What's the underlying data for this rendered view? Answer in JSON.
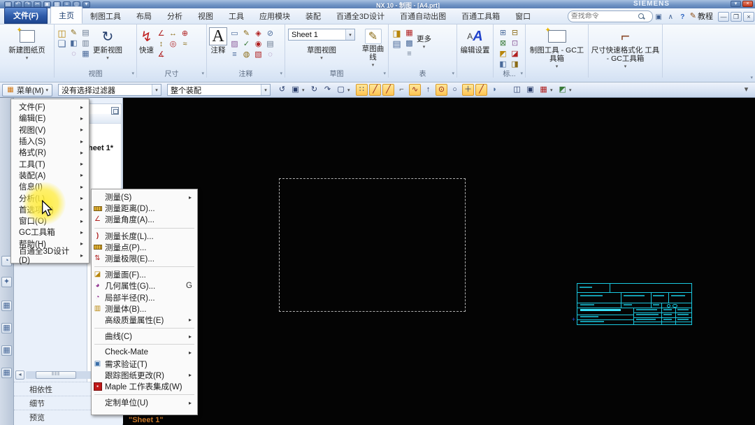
{
  "titlebar": {
    "title": "NX 10 - 制图 - [A4.prt]",
    "brand": "SIEMENS"
  },
  "tabrow": {
    "file_tab": "文件(F)",
    "tabs": [
      "主页",
      "制图工具",
      "布局",
      "分析",
      "视图",
      "工具",
      "应用模块",
      "装配",
      "百通全3D设计",
      "百通自动出图",
      "百通工具箱",
      "窗口"
    ],
    "active_tab": "主页",
    "search_placeholder": "查找命令",
    "tutorial_label": "教程"
  },
  "ribbon": {
    "new_sheet_label": "新建图纸页",
    "view_group": {
      "update_view_label": "更新视图",
      "group_label": "视图"
    },
    "dimension_group": {
      "rapid_label": "快速",
      "group_label": "尺寸"
    },
    "annotation_group": {
      "note_label": "注释",
      "group_label": "注释"
    },
    "sketch_group": {
      "sheet_combo_value": "Sheet 1",
      "sketch_view_label": "草图视图",
      "sketch_curve_label": "草图曲线",
      "group_label": "草图"
    },
    "table_group": {
      "more_label": "更多",
      "group_label": "表"
    },
    "edit_settings_label": "编辑设置",
    "standard_group_label": "标...",
    "gc_drafting_label": "制图工具 - GC工具箱",
    "gc_dimension_label": "尺寸快速格式化 工具 - GC工具箱"
  },
  "toolbar": {
    "menu_button_label": "菜单(M)",
    "selection_filter_value": "没有选择过滤器",
    "selection_scope_value": "整个装配"
  },
  "menu": {
    "items": [
      "文件(F)",
      "编辑(E)",
      "视图(V)",
      "插入(S)",
      "格式(R)",
      "工具(T)",
      "装配(A)",
      "信息(I)",
      "分析(L)",
      "首选项(P)",
      "窗口(O)",
      "GC工具箱",
      "帮助(H)",
      "百通全3D设计(D)"
    ]
  },
  "submenu": {
    "items": [
      {
        "label": "测量(S)"
      },
      {
        "label": "测量距离(D)..."
      },
      {
        "label": "测量角度(A)..."
      },
      {
        "label": "测量长度(L)..."
      },
      {
        "label": "测量点(P)..."
      },
      {
        "label": "测量极限(E)..."
      },
      {
        "label": "测量面(F)..."
      },
      {
        "label": "几何属性(G)...",
        "shortcut": "G"
      },
      {
        "label": "局部半径(R)..."
      },
      {
        "label": "测量体(B)..."
      },
      {
        "label": "高级质量属性(E)"
      },
      {
        "label": "曲线(C)"
      },
      {
        "label": "Check-Mate"
      },
      {
        "label": "需求验证(T)"
      },
      {
        "label": "跟踪图纸更改(R)"
      },
      {
        "label": "Maple 工作表集成(W)"
      },
      {
        "label": "定制单位(U)"
      }
    ]
  },
  "navigator": {
    "sheet_item": "heet 1*",
    "sections": [
      "相依性",
      "细节",
      "预览"
    ]
  },
  "canvas": {
    "sheet_tab_label": "\"Sheet 1\""
  },
  "colors": {
    "click_highlight": "#ffec3c",
    "titleblock_cyan": "#19c8e0",
    "sheet_label_orange": "#c8782a",
    "titlebar_blue": "#6f93c4"
  }
}
